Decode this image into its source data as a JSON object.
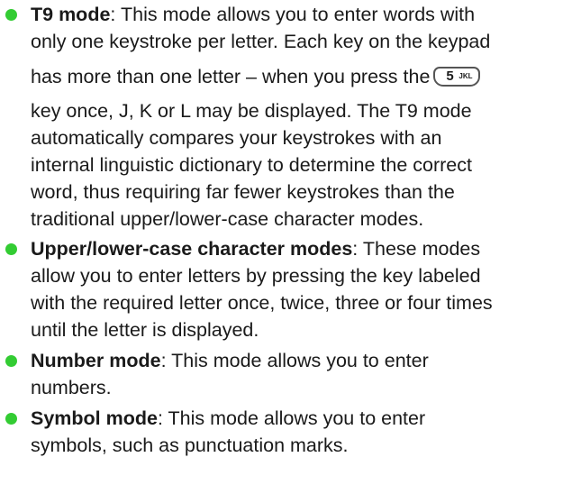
{
  "colors": {
    "bullet": "#33cc33",
    "text": "#1a1a1a"
  },
  "items": [
    {
      "term": "T9 mode",
      "sep": ":",
      "lines": [
        " This mode allows you to enter words with",
        "only one keystroke per letter. Each key on the keypad",
        "has more than one letter – when you press the",
        "key once, J, K or L may be displayed. The T9 mode",
        "automatically compares your keystrokes with an",
        "internal linguistic dictionary to determine the correct",
        "word, thus requiring far fewer keystrokes than the",
        "traditional upper/lower-case character modes."
      ],
      "key": {
        "number": "5",
        "letters": "JKL",
        "icon": "keypad-5-jkl-key-icon"
      }
    },
    {
      "term": "Upper/lower-case character modes",
      "sep": ":",
      "lines": [
        " These modes",
        "allow you to enter letters by pressing the key labeled",
        "with the required letter once, twice, three or four times",
        "until the letter is displayed."
      ]
    },
    {
      "term": "Number mode",
      "sep": ":",
      "lines": [
        " This mode allows you to enter",
        "numbers."
      ]
    },
    {
      "term": "Symbol mode",
      "sep": ":",
      "lines": [
        " This mode allows you to enter",
        "symbols, such as punctuation marks."
      ]
    }
  ]
}
